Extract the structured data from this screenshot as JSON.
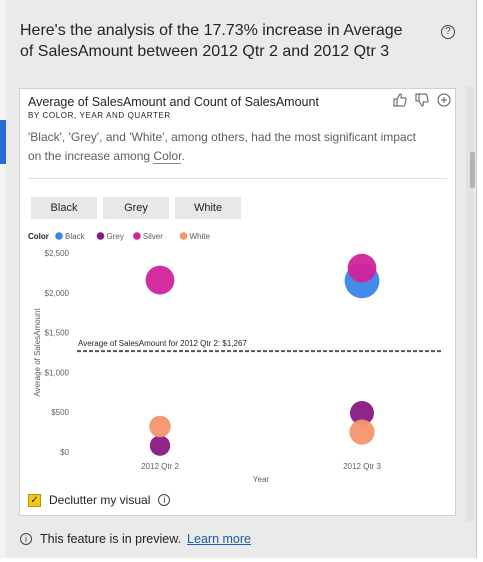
{
  "header": {
    "title": "Here's the analysis of the 17.73% increase in Average of SalesAmount between 2012 Qtr 2 and 2012 Qtr 3",
    "help_icon": "help-icon"
  },
  "card": {
    "title": "Average of SalesAmount and Count of SalesAmount",
    "subtitle": "BY COLOR, YEAR AND QUARTER",
    "actions": [
      "thumbs-up-icon",
      "thumbs-down-icon",
      "add-icon"
    ],
    "explanation_prefix": "'Black', 'Grey', and 'White', among others, had the most significant impact on the increase among ",
    "explanation_link": "Color",
    "explanation_suffix": ".",
    "tabs": [
      "Black",
      "Grey",
      "White"
    ]
  },
  "chart_data": {
    "type": "scatter",
    "legend_title": "Color",
    "legend_position": "top-left",
    "x": [
      "2012 Qtr 2",
      "2012 Qtr 3"
    ],
    "xlabel": "Year",
    "ylabel": "Average of SalesAmount",
    "ylim": [
      0,
      2500
    ],
    "yticks": [
      "$0",
      "$500",
      "$1,000",
      "$1,500",
      "$2,000",
      "$2,500"
    ],
    "grid": false,
    "reference_line": {
      "label": "Average of SalesAmount for 2012 Qtr 2: $1,267",
      "value": 1267
    },
    "series": [
      {
        "name": "Black",
        "color": "#3a86e8",
        "points": [
          {
            "x": "2012 Qtr 3",
            "y": 2150,
            "size": 1.45
          }
        ]
      },
      {
        "name": "Grey",
        "color": "#871a82",
        "points": [
          {
            "x": "2012 Qtr 2",
            "y": 80,
            "size": 0.85
          },
          {
            "x": "2012 Qtr 3",
            "y": 490,
            "size": 1.0
          }
        ]
      },
      {
        "name": "Silver",
        "color": "#d1239c",
        "points": [
          {
            "x": "2012 Qtr 2",
            "y": 2160,
            "size": 1.2
          },
          {
            "x": "2012 Qtr 3",
            "y": 2310,
            "size": 1.2
          }
        ]
      },
      {
        "name": "White",
        "color": "#f4956a",
        "points": [
          {
            "x": "2012 Qtr 2",
            "y": 320,
            "size": 0.9
          },
          {
            "x": "2012 Qtr 3",
            "y": 250,
            "size": 1.05
          }
        ]
      }
    ]
  },
  "declutter": {
    "label": "Declutter my visual",
    "checked": true,
    "check_glyph": "✓"
  },
  "footer": {
    "text": "This feature is in preview.",
    "link": "Learn more"
  }
}
